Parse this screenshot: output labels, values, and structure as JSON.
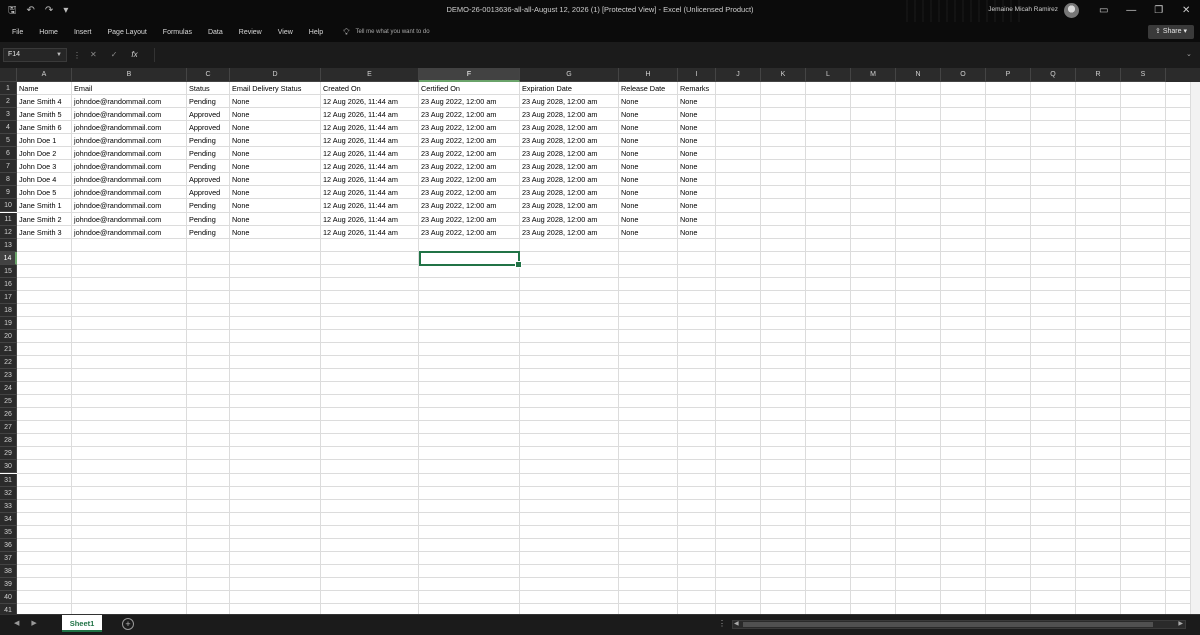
{
  "titlebar": {
    "qat": {
      "save_icon": "save-icon",
      "undo_icon": "undo-icon",
      "redo_icon": "redo-icon",
      "customize_icon": "customize-icon"
    },
    "doc_title": "DEMO-26-0013636-all-all-August 12, 2026 (1)  [Protected View]  -  Excel (Unlicensed Product)",
    "user_name": "Jemaine Micah Ramirez",
    "window_buttons": {
      "ribbon_display": "▭",
      "minimize": "—",
      "restore": "❐",
      "close": "✕"
    }
  },
  "ribbon": {
    "tabs": [
      "File",
      "Home",
      "Insert",
      "Page Layout",
      "Formulas",
      "Data",
      "Review",
      "View",
      "Help"
    ],
    "tell_me": "Tell me what you want to do",
    "share_label": "Share"
  },
  "formula_bar": {
    "name_box": "F14",
    "fx_label": "fx",
    "value": ""
  },
  "grid": {
    "columns": [
      "A",
      "B",
      "C",
      "D",
      "E",
      "F",
      "G",
      "H",
      "I",
      "J",
      "K",
      "L",
      "M",
      "N",
      "O",
      "P",
      "Q",
      "R",
      "S"
    ],
    "selected_column": "F",
    "selected_row": 14,
    "rows": 42,
    "data": [
      [
        "Name",
        "Email",
        "Status",
        "Email Delivery Status",
        "Created On",
        "Certified On",
        "Expiration Date",
        "Release Date",
        "Remarks"
      ],
      [
        "Jane Smith 4",
        "johndoe@randommail.com",
        "Pending",
        "None",
        "12 Aug 2026, 11:44 am",
        "23 Aug 2022, 12:00 am",
        "23 Aug 2028, 12:00 am",
        "None",
        "None"
      ],
      [
        "Jane Smith 5",
        "johndoe@randommail.com",
        "Approved",
        "None",
        "12 Aug 2026, 11:44 am",
        "23 Aug 2022, 12:00 am",
        "23 Aug 2028, 12:00 am",
        "None",
        "None"
      ],
      [
        "Jane Smith 6",
        "johndoe@randommail.com",
        "Approved",
        "None",
        "12 Aug 2026, 11:44 am",
        "23 Aug 2022, 12:00 am",
        "23 Aug 2028, 12:00 am",
        "None",
        "None"
      ],
      [
        "John Doe 1",
        "johndoe@randommail.com",
        "Pending",
        "None",
        "12 Aug 2026, 11:44 am",
        "23 Aug 2022, 12:00 am",
        "23 Aug 2028, 12:00 am",
        "None",
        "None"
      ],
      [
        "John Doe 2",
        "johndoe@randommail.com",
        "Pending",
        "None",
        "12 Aug 2026, 11:44 am",
        "23 Aug 2022, 12:00 am",
        "23 Aug 2028, 12:00 am",
        "None",
        "None"
      ],
      [
        "John Doe 3",
        "johndoe@randommail.com",
        "Pending",
        "None",
        "12 Aug 2026, 11:44 am",
        "23 Aug 2022, 12:00 am",
        "23 Aug 2028, 12:00 am",
        "None",
        "None"
      ],
      [
        "John Doe 4",
        "johndoe@randommail.com",
        "Approved",
        "None",
        "12 Aug 2026, 11:44 am",
        "23 Aug 2022, 12:00 am",
        "23 Aug 2028, 12:00 am",
        "None",
        "None"
      ],
      [
        "John Doe 5",
        "johndoe@randommail.com",
        "Approved",
        "None",
        "12 Aug 2026, 11:44 am",
        "23 Aug 2022, 12:00 am",
        "23 Aug 2028, 12:00 am",
        "None",
        "None"
      ],
      [
        "Jane Smith 1",
        "johndoe@randommail.com",
        "Pending",
        "None",
        "12 Aug 2026, 11:44 am",
        "23 Aug 2022, 12:00 am",
        "23 Aug 2028, 12:00 am",
        "None",
        "None"
      ],
      [
        "Jane Smith 2",
        "johndoe@randommail.com",
        "Pending",
        "None",
        "12 Aug 2026, 11:44 am",
        "23 Aug 2022, 12:00 am",
        "23 Aug 2028, 12:00 am",
        "None",
        "None"
      ],
      [
        "Jane Smith 3",
        "johndoe@randommail.com",
        "Pending",
        "None",
        "12 Aug 2026, 11:44 am",
        "23 Aug 2022, 12:00 am",
        "23 Aug 2028, 12:00 am",
        "None",
        "None"
      ]
    ]
  },
  "sheets": {
    "tabs": [
      "Sheet1"
    ],
    "active": "Sheet1",
    "add_label": "+"
  },
  "colors": {
    "accent": "#217346",
    "chrome": "#0b0b0b",
    "grid_line": "#dcdcdc"
  }
}
